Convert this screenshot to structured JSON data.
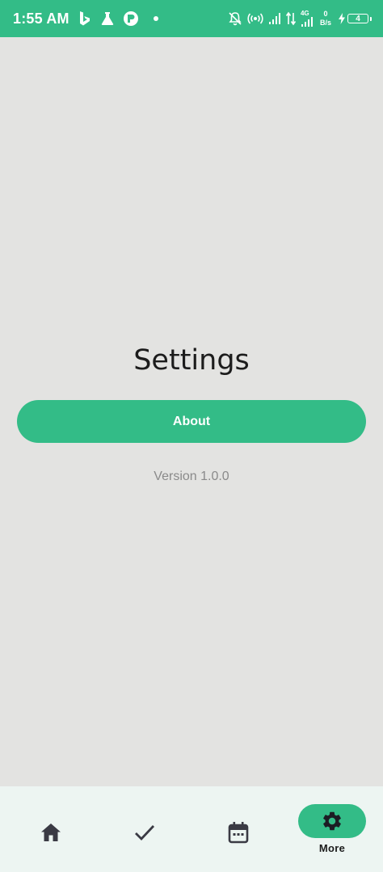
{
  "status_bar": {
    "time": "1:55 AM",
    "network": "4G",
    "speed_value": "0",
    "speed_unit": "B/s",
    "battery_level": "4",
    "left_icons": [
      "bing-icon",
      "flask-icon",
      "circle-app-icon",
      "dot-icon"
    ],
    "right_icons": [
      "notifications-off-icon",
      "hotspot-icon",
      "signal-icon",
      "data-arrows-icon",
      "signal-4g-icon",
      "charging-icon",
      "battery-icon"
    ]
  },
  "page": {
    "title": "Settings",
    "about_label": "About",
    "version": "Version 1.0.0"
  },
  "nav": {
    "items": [
      {
        "icon": "home-icon",
        "label": ""
      },
      {
        "icon": "check-icon",
        "label": ""
      },
      {
        "icon": "calendar-icon",
        "label": ""
      },
      {
        "icon": "gear-icon",
        "label": "More",
        "active": true
      }
    ]
  },
  "colors": {
    "accent": "#33bc87",
    "background": "#e3e3e1",
    "nav_background": "#edf5f2",
    "title_text": "#1c1c1c",
    "muted_text": "#8a8a8a",
    "icon": "#3a3a44"
  }
}
